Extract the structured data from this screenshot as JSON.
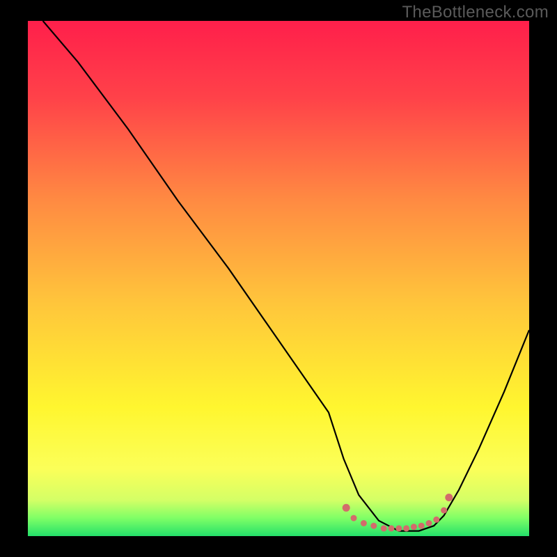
{
  "watermark": "TheBottleneck.com",
  "chart_data": {
    "type": "line",
    "title": "",
    "xlabel": "",
    "ylabel": "",
    "xlim": [
      0,
      100
    ],
    "ylim": [
      0,
      100
    ],
    "series": [
      {
        "name": "bottleneck-curve",
        "color": "#000000",
        "x": [
          3,
          10,
          20,
          30,
          40,
          50,
          60,
          63,
          66,
          70,
          74,
          78,
          81,
          83,
          86,
          90,
          95,
          100
        ],
        "y": [
          100,
          92,
          79,
          65,
          52,
          38,
          24,
          15,
          8,
          3,
          1,
          1,
          2,
          4,
          9,
          17,
          28,
          40
        ]
      },
      {
        "name": "optimal-region",
        "color": "#d36b6b",
        "type": "scatter",
        "x": [
          63.5,
          65,
          67,
          69,
          71,
          72.5,
          74,
          75.5,
          77,
          78.5,
          80,
          81.5,
          83,
          84
        ],
        "y": [
          5.5,
          3.5,
          2.5,
          2,
          1.5,
          1.5,
          1.5,
          1.5,
          1.8,
          2,
          2.5,
          3.2,
          5,
          7.5
        ]
      }
    ],
    "background_gradient": {
      "type": "vertical",
      "stops": [
        {
          "offset": 0.0,
          "color": "#ff1f4b"
        },
        {
          "offset": 0.15,
          "color": "#ff4249"
        },
        {
          "offset": 0.35,
          "color": "#ff8b42"
        },
        {
          "offset": 0.55,
          "color": "#ffc63b"
        },
        {
          "offset": 0.75,
          "color": "#fff62f"
        },
        {
          "offset": 0.87,
          "color": "#fbff59"
        },
        {
          "offset": 0.93,
          "color": "#d4ff66"
        },
        {
          "offset": 0.965,
          "color": "#7fff66"
        },
        {
          "offset": 1.0,
          "color": "#24e06a"
        }
      ]
    }
  }
}
